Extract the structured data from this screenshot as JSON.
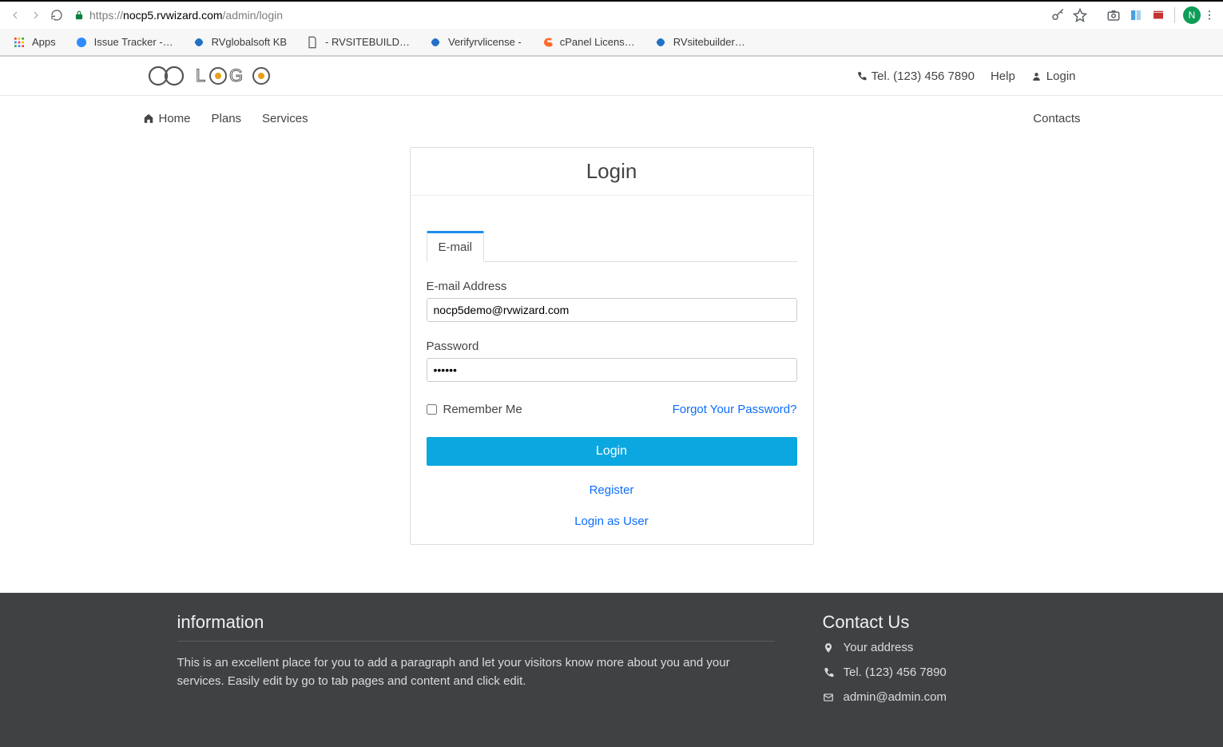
{
  "browser": {
    "url_host": "nocp5.rvwizard.com",
    "url_path": "/admin/login",
    "avatar": "N",
    "bookmarks": [
      {
        "label": "Apps"
      },
      {
        "label": "Issue Tracker -…"
      },
      {
        "label": "RVglobalsoft KB"
      },
      {
        "label": "- RVSITEBUILD…"
      },
      {
        "label": "Verifyrvlicense -"
      },
      {
        "label": "cPanel  Licens…"
      },
      {
        "label": "RVsitebuilder…"
      }
    ]
  },
  "header": {
    "tel": "Tel. (123) 456 7890",
    "help": "Help",
    "login": "Login"
  },
  "nav": {
    "home": "Home",
    "plans": "Plans",
    "services": "Services",
    "contacts": "Contacts"
  },
  "login_card": {
    "title": "Login",
    "tab": "E-mail",
    "email_label": "E-mail Address",
    "email_value": "nocp5demo@rvwizard.com",
    "password_label": "Password",
    "password_value": "••••••",
    "remember": "Remember Me",
    "forgot": "Forgot Your Password?",
    "submit": "Login",
    "register": "Register",
    "login_as_user": "Login as User"
  },
  "footer": {
    "info_title": "information",
    "info_text": "This is an excellent place for you to add a paragraph and let your visitors know more about you and your services. Easily edit by go to tab pages and content and click edit.",
    "contact_title": "Contact Us",
    "address": "Your address",
    "tel": "Tel. (123) 456 7890",
    "email": "admin@admin.com"
  }
}
